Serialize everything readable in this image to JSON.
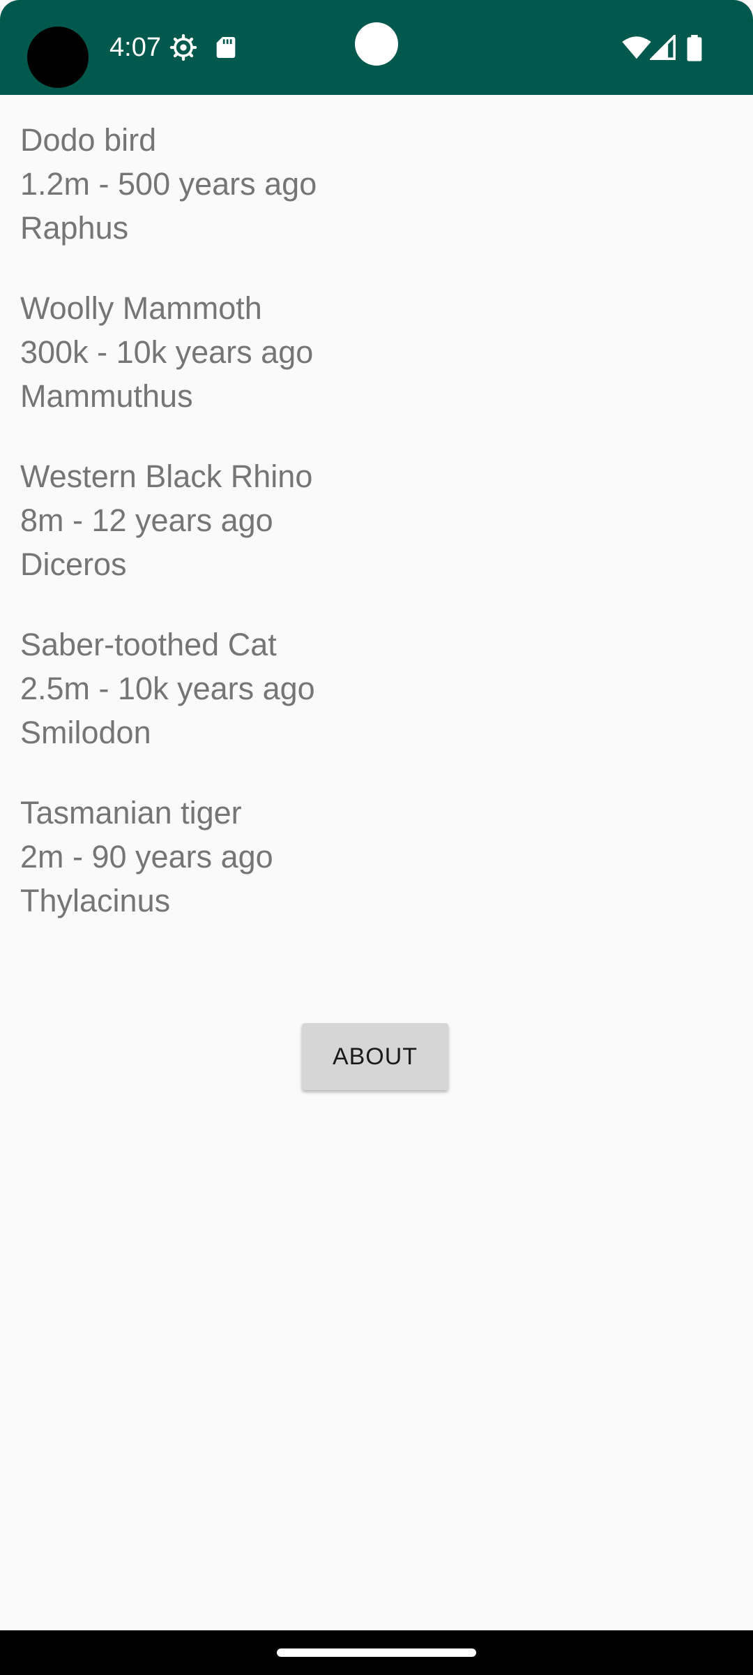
{
  "status_bar": {
    "time": "4:07",
    "icons": [
      "gear-icon",
      "sdcard-icon",
      "wifi-icon",
      "signal-icon",
      "battery-icon"
    ],
    "background_color": "#00594c"
  },
  "species": [
    {
      "name": "Dodo bird",
      "detail": "1.2m - 500 years ago",
      "genus": "Raphus"
    },
    {
      "name": "Woolly Mammoth",
      "detail": "300k - 10k years ago",
      "genus": "Mammuthus"
    },
    {
      "name": "Western Black Rhino",
      "detail": "8m - 12 years ago",
      "genus": "Diceros"
    },
    {
      "name": "Saber-toothed Cat",
      "detail": "2.5m - 10k years ago",
      "genus": "Smilodon"
    },
    {
      "name": "Tasmanian tiger",
      "detail": "2m - 90 years ago",
      "genus": "Thylacinus"
    }
  ],
  "about_button": {
    "label": "ABOUT"
  },
  "colors": {
    "text": "#757575",
    "background": "#fafafa",
    "button": "#d6d6d6"
  }
}
